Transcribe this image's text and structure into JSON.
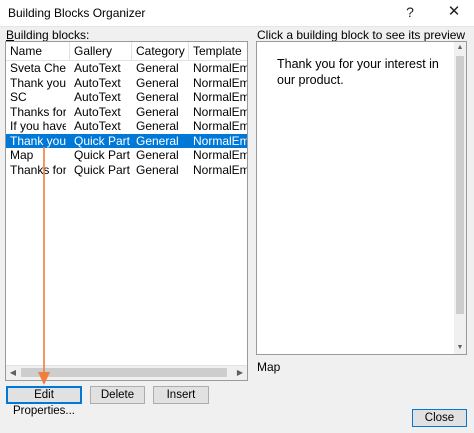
{
  "window": {
    "title": "Building Blocks Organizer",
    "help": "?",
    "close": "✕"
  },
  "list": {
    "label": "Building blocks:",
    "columns": [
      "Name",
      "Gallery",
      "Category",
      "Template"
    ],
    "rows": [
      [
        "Sveta Cheu...",
        "AutoText",
        "General",
        "NormalEmai..."
      ],
      [
        "Thank you",
        "AutoText",
        "General",
        "NormalEmai..."
      ],
      [
        "SC",
        "AutoText",
        "General",
        "NormalEmai..."
      ],
      [
        "Thanks for ...",
        "AutoText",
        "General",
        "NormalEmai..."
      ],
      [
        "If you have",
        "AutoText",
        "General",
        "NormalEmai..."
      ],
      [
        "Thank you",
        "Quick Parts",
        "General",
        "NormalEmai..."
      ],
      [
        "Map",
        "Quick Parts",
        "General",
        "NormalEmai..."
      ],
      [
        "Thanks for ...",
        "Quick Parts",
        "General",
        "NormalEmai..."
      ]
    ],
    "selected_row": 5
  },
  "preview": {
    "label": "Click a building block to see its preview",
    "text": "Thank you for your interest in our product.",
    "block_name": "Map"
  },
  "buttons": {
    "edit": "Edit Properties...",
    "delete": "Delete",
    "insert": "Insert",
    "close": "Close"
  },
  "colors": {
    "selection": "#0078d7",
    "annotation_arrow": "#f07f3c"
  }
}
